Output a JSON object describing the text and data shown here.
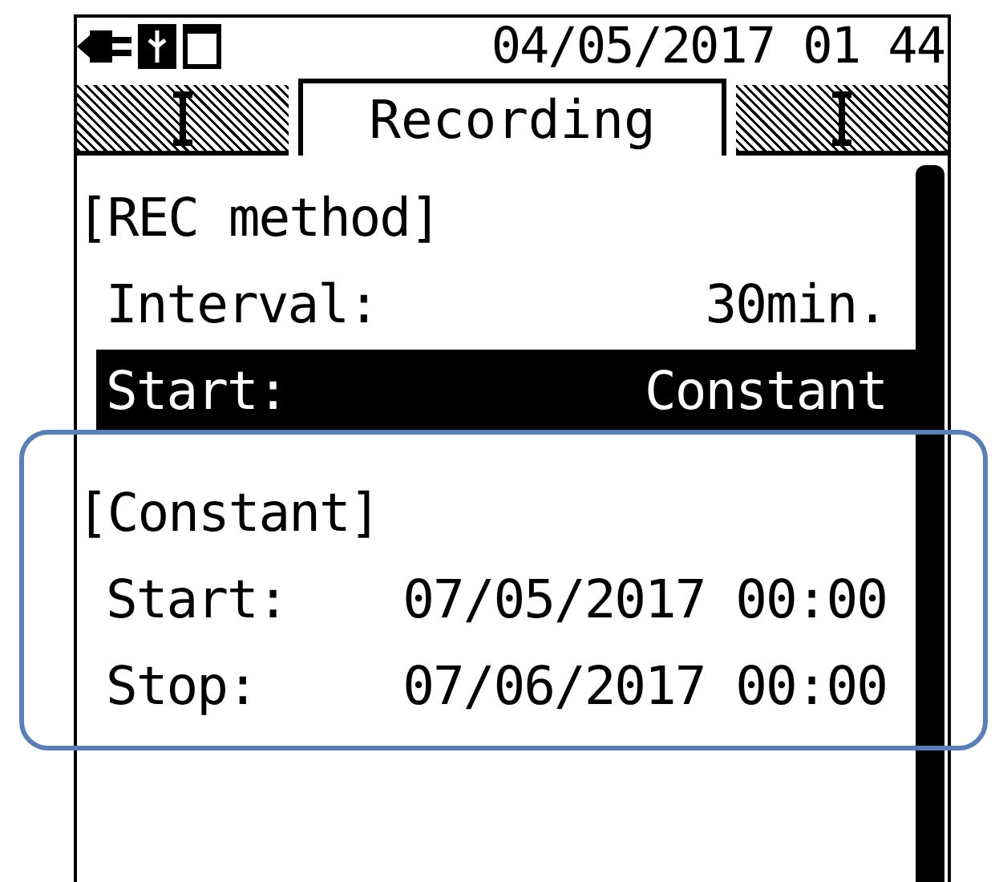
{
  "status_bar": {
    "datetime": "04/05/2017 01 44"
  },
  "tabs": [
    {
      "selected": false
    },
    {
      "label": "Recording",
      "selected": true
    },
    {
      "selected": false
    }
  ],
  "sections": [
    {
      "title": "[REC method]",
      "rows": [
        {
          "label": "Interval:",
          "value": "30min.",
          "selected": false
        },
        {
          "label": "Start:",
          "value": "Constant",
          "selected": true
        }
      ]
    },
    {
      "title": "[Constant]",
      "rows": [
        {
          "label": "Start:",
          "value": "07/05/2017 00:00",
          "selected": false
        },
        {
          "label": "Stop:",
          "value": "07/06/2017 00:00",
          "selected": false
        }
      ]
    }
  ]
}
